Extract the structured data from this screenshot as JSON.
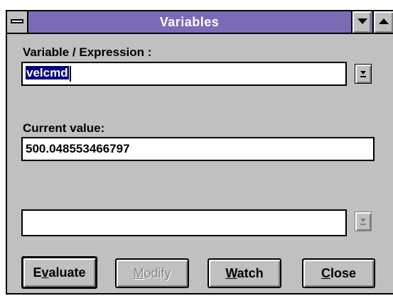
{
  "window": {
    "title": "Variables",
    "sysmenu_icon": "system-menu-icon",
    "minimize_icon": "minimize-arrow-icon",
    "maximize_icon": "maximize-arrow-icon"
  },
  "expression": {
    "label": "Variable / Expression :",
    "value": "velcmd",
    "dropdown_icon": "dropdown-arrow-icon"
  },
  "current_value": {
    "label": "Current value:",
    "value": "500.048553466797"
  },
  "new_value": {
    "value": "",
    "dropdown_icon": "dropdown-arrow-icon"
  },
  "buttons": {
    "evaluate": {
      "pre": "E",
      "mnemonic": "v",
      "post": "aluate"
    },
    "modify": {
      "pre": "",
      "mnemonic": "M",
      "post": "odify"
    },
    "watch": {
      "pre": "",
      "mnemonic": "W",
      "post": "atch"
    },
    "close": {
      "pre": "",
      "mnemonic": "C",
      "post": "lose"
    }
  },
  "colors": {
    "titlebar": "#7b6bb7",
    "face": "#c0c0c0",
    "selection": "#000080"
  }
}
